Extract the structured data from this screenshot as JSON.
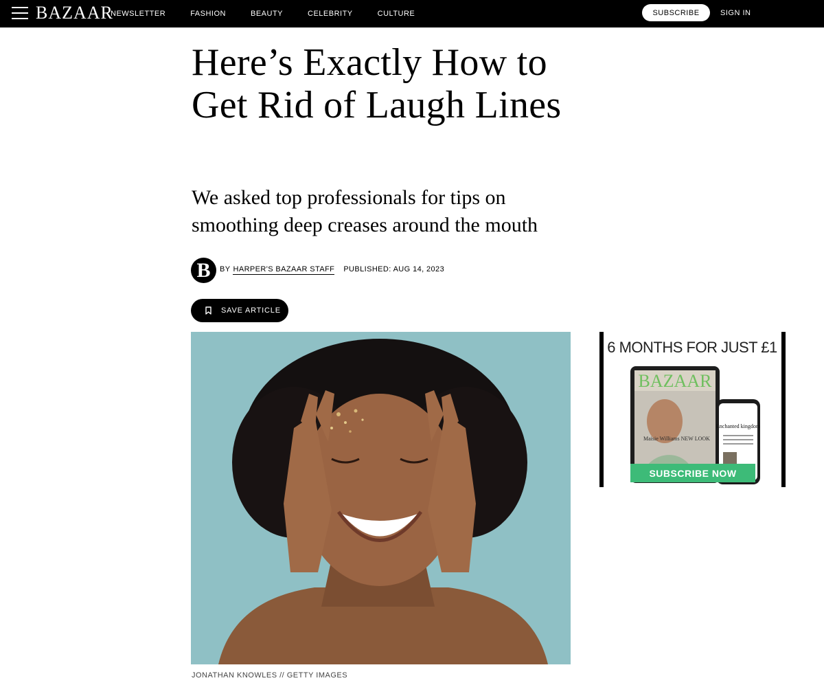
{
  "nav": {
    "logo": "BAZAAR",
    "links": [
      "NEWSLETTER",
      "FASHION",
      "BEAUTY",
      "CELEBRITY",
      "CULTURE"
    ],
    "subscribe_label": "SUBSCRIBE",
    "signin_label": "SIGN IN"
  },
  "article": {
    "headline": "Here’s Exactly How to Get Rid of Laugh Lines",
    "dek": "We asked top professionals for tips on smoothing deep creases around the mouth",
    "author_initial": "B",
    "by_label": "BY",
    "author": "HARPER'S BAZAAR STAFF",
    "published": "PUBLISHED: AUG 14, 2023",
    "save_label": "SAVE ARTICLE",
    "image_caption": "JONATHAN KNOWLES // GETTY IMAGES"
  },
  "ad": {
    "headline": "6 MONTHS FOR JUST £1",
    "magazine_logo": "BAZAAR",
    "cover_text": "Maisie Williams NEW LOOK",
    "phone_text": "Enchanted kingdom",
    "cta": "SUBSCRIBE NOW"
  },
  "colors": {
    "nav_bg": "#000000",
    "photo_bg": "#8fc0c5",
    "ad_cta": "#3dbb78"
  }
}
